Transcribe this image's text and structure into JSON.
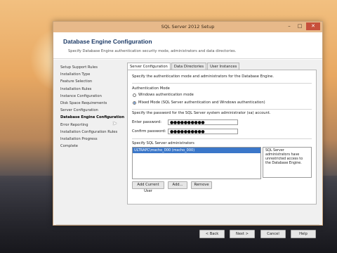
{
  "window": {
    "title": "SQL Server 2012 Setup"
  },
  "header": {
    "title": "Database Engine Configuration",
    "subtitle": "Specify Database Engine authentication security mode, administrators and data directories."
  },
  "nav": {
    "items": [
      {
        "label": "Setup Support Rules"
      },
      {
        "label": "Installation Type"
      },
      {
        "label": "Feature Selection"
      },
      {
        "label": "Installation Rules"
      },
      {
        "label": "Instance Configuration"
      },
      {
        "label": "Disk Space Requirements"
      },
      {
        "label": "Server Configuration"
      },
      {
        "label": "Database Engine Configuration"
      },
      {
        "label": "Error Reporting"
      },
      {
        "label": "Installation Configuration Rules"
      },
      {
        "label": "Installation Progress"
      },
      {
        "label": "Complete"
      }
    ]
  },
  "tabs": [
    {
      "label": "Server Configuration"
    },
    {
      "label": "Data Directories"
    },
    {
      "label": "User Instances"
    }
  ],
  "server_config": {
    "intro": "Specify the authentication mode and administrators for the Database Engine.",
    "auth_mode_label": "Authentication Mode",
    "radio_windows": "Windows authentication mode",
    "radio_mixed": "Mixed Mode (SQL Server authentication and Windows authentication)",
    "pw_section": "Specify the password for the SQL Server system administrator (sa) account.",
    "enter_password_label": "Enter password:",
    "enter_password_value": "●●●●●●●●●●",
    "confirm_password_label": "Confirm password:",
    "confirm_password_value": "●●●●●●●●●●",
    "admins_label": "Specify SQL Server administrators",
    "admin_entry": "ULTRAPC\\mscho_000 (mscho_000)",
    "admins_note": "SQL Server administrators have unrestricted access to the Database Engine.",
    "add_current_user": "Add Current User",
    "add": "Add...",
    "remove": "Remove"
  },
  "footer": {
    "back": "< Back",
    "next": "Next >",
    "cancel": "Cancel",
    "help": "Help"
  },
  "colors": {
    "accent": "#1c3a66",
    "titlebar": "#e7b98a",
    "selection": "#3b77c9"
  }
}
